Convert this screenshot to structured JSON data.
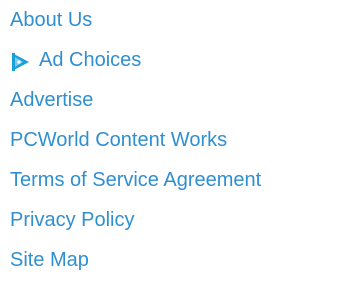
{
  "footer": {
    "links": [
      {
        "id": "about-us",
        "label": "About Us",
        "icon": null
      },
      {
        "id": "ad-choices",
        "label": "Ad Choices",
        "icon": "adchoices-icon"
      },
      {
        "id": "advertise",
        "label": "Advertise",
        "icon": null
      },
      {
        "id": "pcworld-content-works",
        "label": "PCWorld Content Works",
        "icon": null
      },
      {
        "id": "terms-of-service",
        "label": "Terms of Service Agreement",
        "icon": null
      },
      {
        "id": "privacy-policy",
        "label": "Privacy Policy",
        "icon": null
      },
      {
        "id": "site-map",
        "label": "Site Map",
        "icon": null
      }
    ],
    "colors": {
      "link": "#2f8fd0",
      "adchoices_dark": "#1a9fd9",
      "adchoices_light": "#7ccbef"
    }
  }
}
